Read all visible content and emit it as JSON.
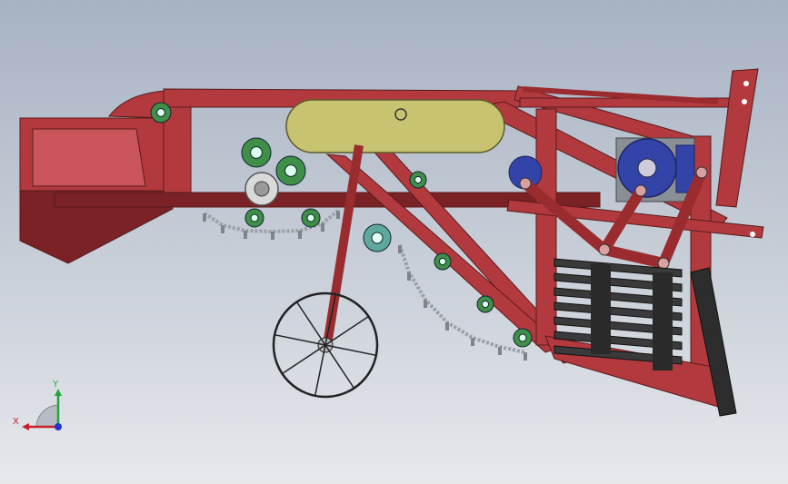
{
  "colors": {
    "frame": "#b23a3e",
    "frame_dark": "#7a2226",
    "frame_light": "#c9555a",
    "belt": "#c7c370",
    "roller_green": "#3f8f48",
    "roller_teal": "#5fa89c",
    "motor_blue": "#3344a8",
    "chain": "#9aa0a6",
    "grate": "#3a3a3a",
    "wheel": "#222222",
    "axis_x": "#c8202a",
    "axis_y": "#22a63a",
    "axis_z": "#2233cc"
  },
  "triad": {
    "x_label": "X",
    "y_label": "Y"
  }
}
